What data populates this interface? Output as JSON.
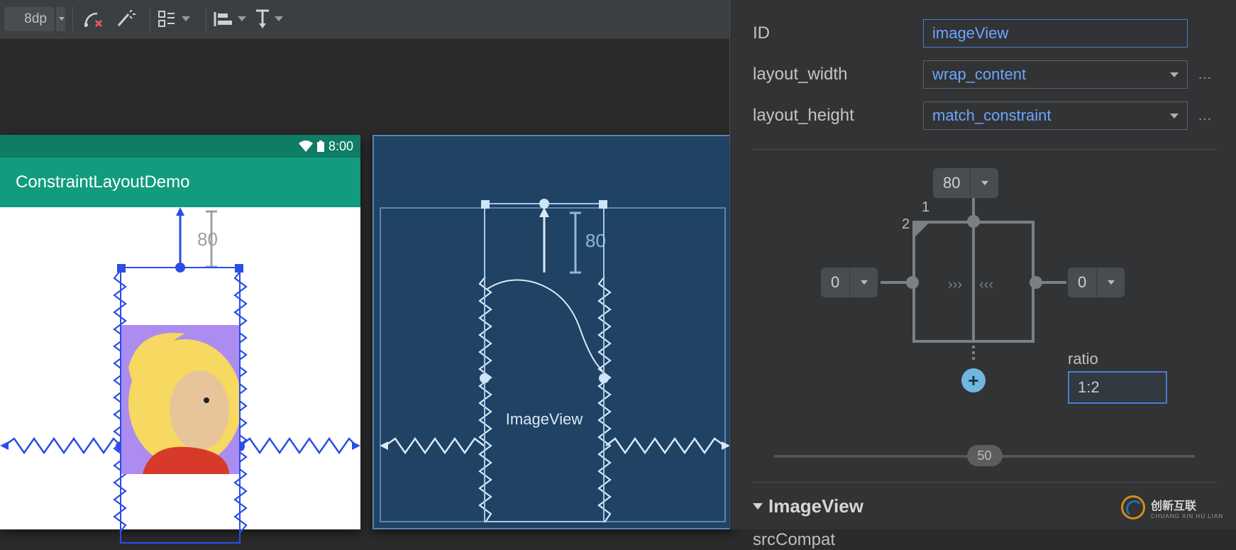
{
  "toolbar": {
    "margin_default": "8dp"
  },
  "statusbar": {
    "time": "8:00"
  },
  "app": {
    "title": "ConstraintLayoutDemo"
  },
  "design_view": {
    "margin_top": "80",
    "selected_element": "ImageView"
  },
  "blueprint_view": {
    "margin_top": "80",
    "label": "ImageView"
  },
  "attrs": {
    "id_label": "ID",
    "id_value": "imageView",
    "layout_width_label": "layout_width",
    "layout_width_value": "wrap_content",
    "layout_height_label": "layout_height",
    "layout_height_value": "match_constraint",
    "constraint_widget": {
      "margin_top": "80",
      "margin_left": "0",
      "margin_right": "0",
      "ratio_label": "ratio",
      "ratio_value": "1:2",
      "ratio_corner_1": "1",
      "ratio_corner_2": "2"
    },
    "bias_slider": "50",
    "section_header": "ImageView",
    "srcCompat_label": "srcCompat"
  },
  "watermark": {
    "line1": "创新互联",
    "line2": "CHUANG XIN HU LIAN"
  }
}
